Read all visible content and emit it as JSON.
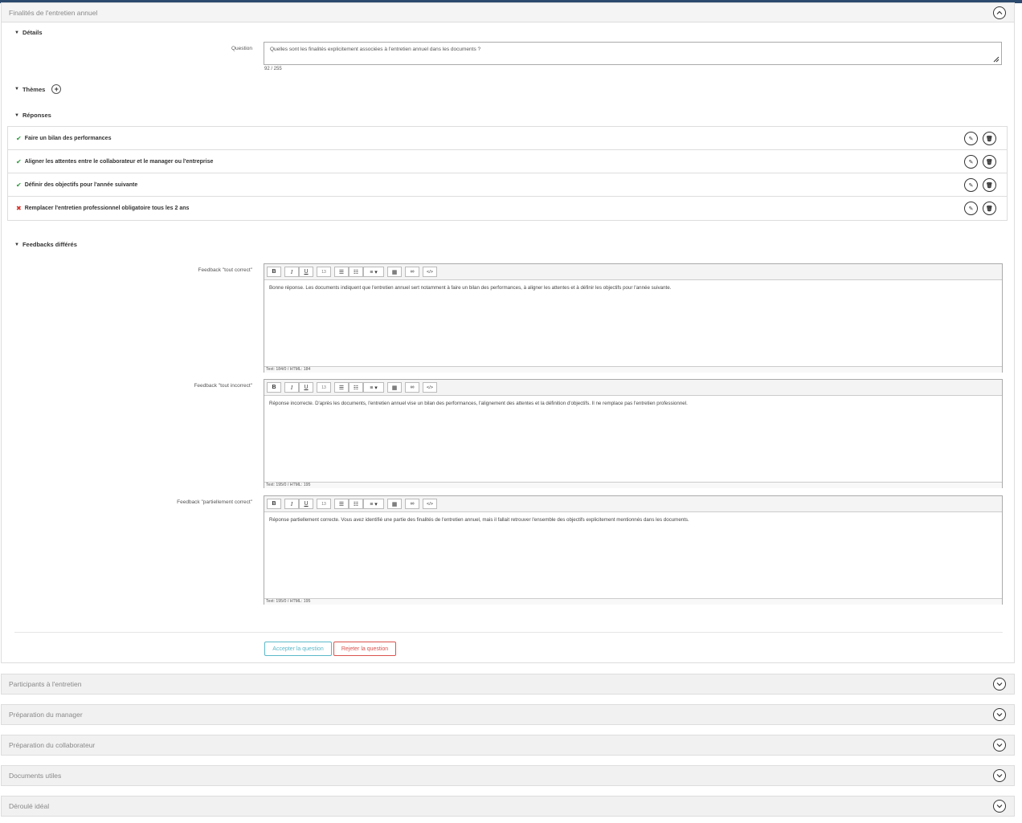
{
  "main_panel": {
    "title": "Finalités de l'entretien annuel",
    "details": {
      "title": "Détails",
      "question_label": "Question",
      "question_value": "Quelles sont les finalités explicitement associées à l'entretien annuel dans les documents ?",
      "char_count": "92 / 255"
    },
    "themes": {
      "title": "Thèmes"
    },
    "responses": {
      "title": "Réponses",
      "items": [
        {
          "label": "Faire un bilan des performances",
          "correct": true
        },
        {
          "label": "Aligner les attentes entre le collaborateur et le manager ou l'entreprise",
          "correct": true
        },
        {
          "label": "Définir des objectifs pour l'année suivante",
          "correct": true
        },
        {
          "label": "Remplacer l'entretien professionnel obligatoire tous les 2 ans",
          "correct": false
        }
      ]
    },
    "feedbacks": {
      "title": "Feedbacks différés",
      "toolbar": {
        "bold": "B",
        "italic": "I",
        "underline": "U",
        "size": "13",
        "code": "</>"
      },
      "items": [
        {
          "label": "Feedback \"tout correct\"",
          "text": "Bonne réponse. Les documents indiquent que l'entretien annuel sert notamment à faire un bilan des performances, à aligner les attentes et à définir les objectifs pour l'année suivante.",
          "footer": "Text: 184/0 / HTML: 184"
        },
        {
          "label": "Feedback \"tout incorrect\"",
          "text": "Réponse incorrecte. D'après les documents, l'entretien annuel vise un bilan des performances, l'alignement des attentes et la définition d'objectifs. Il ne remplace pas l'entretien professionnel.",
          "footer": "Text: 195/0 / HTML: 195"
        },
        {
          "label": "Feedback \"partiellement correct\"",
          "text": "Réponse partiellement correcte. Vous avez identifié une partie des finalités de l'entretien annuel, mais il fallait retrouver l'ensemble des objectifs explicitement mentionnés dans les documents.",
          "footer": "Text: 195/0 / HTML: 195"
        }
      ]
    },
    "accept_label": "Accepter la question",
    "reject_label": "Rejeter la question"
  },
  "collapsed_panels": [
    {
      "title": "Participants à l'entretien"
    },
    {
      "title": "Préparation du manager"
    },
    {
      "title": "Préparation du collaborateur"
    },
    {
      "title": "Documents utiles"
    },
    {
      "title": "Déroulé idéal"
    }
  ],
  "colors": {
    "accent_bar": "#2c4a6e",
    "check": "#2a9a3a",
    "cross": "#d9302a",
    "accept": "#5bb8c9",
    "reject": "#d9534f"
  }
}
